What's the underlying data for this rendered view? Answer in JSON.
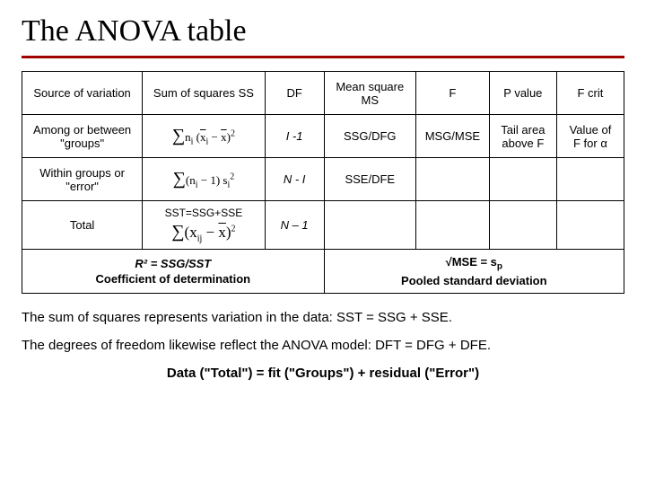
{
  "title": "The ANOVA table",
  "headers": {
    "source": "Source of variation",
    "ss": "Sum of squares SS",
    "df": "DF",
    "ms": "Mean square MS",
    "f": "F",
    "p": "P value",
    "fcrit": "F crit"
  },
  "rows": {
    "among": {
      "source": "Among or between \"groups\"",
      "df": "I -1",
      "ms": "SSG/DFG",
      "f": "MSG/MSE",
      "p": "Tail area above F",
      "fcrit": "Value of F for α"
    },
    "within": {
      "source": "Within groups or \"error\"",
      "df": "N - I",
      "ms": "SSE/DFE"
    },
    "total": {
      "source": "Total",
      "ss": "SST=SSG+SSE",
      "df": "N – 1"
    }
  },
  "footer": {
    "left_line1": "R² = SSG/SST",
    "left_line2": "Coefficient of determination",
    "right_line1_pre": "√MSE = s",
    "right_line1_sub": "p",
    "right_line2": "Pooled standard deviation"
  },
  "paragraphs": {
    "p1": "The sum of squares represents variation in the data: SST = SSG + SSE.",
    "p2": "The degrees of freedom likewise reflect the ANOVA model: DFT = DFG + DFE.",
    "p3": "Data (\"Total\") = fit (\"Groups\") + residual (\"Error\")"
  }
}
